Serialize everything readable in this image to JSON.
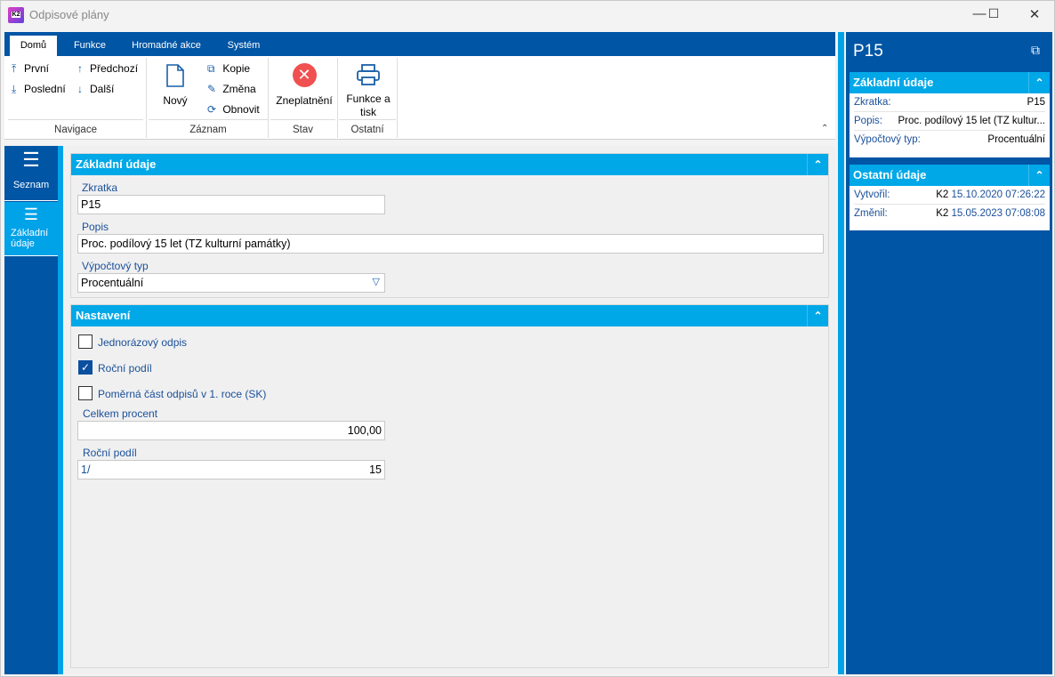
{
  "window": {
    "title": "Odpisové plány",
    "logo": "K2"
  },
  "ribbon": {
    "tabs": [
      "Domů",
      "Funkce",
      "Hromadné akce",
      "Systém"
    ],
    "navigace": {
      "label": "Navigace",
      "prvni": "První",
      "posledni": "Poslední",
      "predchozi": "Předchozí",
      "dalsi": "Další"
    },
    "zaznam": {
      "label": "Záznam",
      "novy": "Nový",
      "kopie": "Kopie",
      "zmena": "Změna",
      "obnovit": "Obnovit"
    },
    "stav": {
      "label": "Stav",
      "zneplatneni": "Zneplatnění"
    },
    "ostatni": {
      "label": "Ostatní",
      "funkce_line1": "Funkce a",
      "funkce_line2": "tisk"
    }
  },
  "nav": {
    "seznam": "Seznam",
    "zakladni_line1": "Základní",
    "zakladni_line2": "údaje"
  },
  "zakladni": {
    "title": "Základní údaje",
    "zkratka_label": "Zkratka",
    "zkratka": "P15",
    "popis_label": "Popis",
    "popis": "Proc. podílový 15 let (TZ kulturní památky)",
    "typ_label": "Výpočtový typ",
    "typ": "Procentuální"
  },
  "nastaveni": {
    "title": "Nastavení",
    "checkboxes": [
      {
        "label": "Jednorázový odpis",
        "checked": false
      },
      {
        "label": "Roční podíl",
        "checked": true
      },
      {
        "label": "Poměrná část odpisů v 1. roce (SK)",
        "checked": false
      }
    ],
    "celkem_label": "Celkem procent",
    "celkem": "100,00",
    "rocni_label": "Roční podíl",
    "rocni_prefix": "1/",
    "rocni": "15"
  },
  "panel": {
    "title": "P15",
    "zakladni": {
      "title": "Základní údaje",
      "zkratka_k": "Zkratka:",
      "zkratka_v": "P15",
      "popis_k": "Popis:",
      "popis_v": "Proc. podílový 15 let (TZ kultur...",
      "typ_k": "Výpočtový typ:",
      "typ_v": "Procentuální"
    },
    "ostatni": {
      "title": "Ostatní údaje",
      "vytvoril_k": "Vytvořil:",
      "vytvoril_user": "K2",
      "vytvoril_dt": "15.10.2020 07:26:22",
      "zmenil_k": "Změnil:",
      "zmenil_user": "K2",
      "zmenil_dt": "15.05.2023 07:08:08"
    }
  },
  "colors": {
    "primary": "#0055a5",
    "accent": "#00a8e8",
    "cancel": "#f05050"
  }
}
